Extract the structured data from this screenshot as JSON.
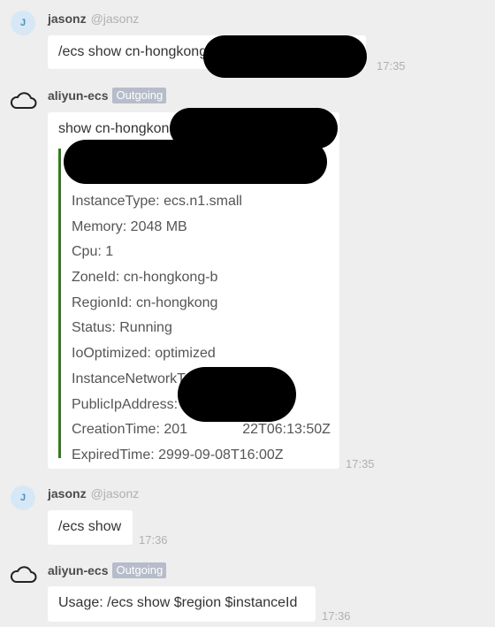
{
  "messages": [
    {
      "sender": "jasonz",
      "handle": "@jasonz",
      "avatar_letter": "J",
      "text": "/ecs show cn-hongkong",
      "time": "17:35"
    },
    {
      "sender": "aliyun-ecs",
      "badge": "Outgoing",
      "avatar_icon": "cloud-icon",
      "text": "show cn-hongkong",
      "time": "17:35",
      "attachment_lines": [
        "InstanceType: ecs.n1.small",
        "Memory: 2048 MB",
        "Cpu: 1",
        "ZoneId: cn-hongkong-b",
        "RegionId: cn-hongkong",
        "Status: Running",
        "IoOptimized: optimized",
        "InstanceNetworkType: classic",
        "PublicIpAddress:",
        "CreationTime: 201              22T06:13:50Z",
        "ExpiredTime: 2999-09-08T16:00Z"
      ]
    },
    {
      "sender": "jasonz",
      "handle": "@jasonz",
      "avatar_letter": "J",
      "text": "/ecs show",
      "time": "17:36"
    },
    {
      "sender": "aliyun-ecs",
      "badge": "Outgoing",
      "avatar_icon": "cloud-icon",
      "text": "Usage: /ecs show $region $instanceId",
      "time": "17:36"
    }
  ]
}
